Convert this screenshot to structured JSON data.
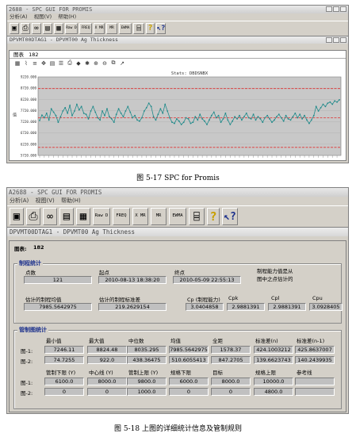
{
  "top": {
    "app_title": "2688 - SPC GUI FOR PROMIS",
    "menu": [
      "分析(A)",
      "视图(V)",
      "帮助(H)"
    ],
    "toolbar_labels": [
      "Raw D",
      "FREQ",
      "X MR",
      "MR",
      "EWMA"
    ],
    "doc_title": "DPVMT00DTAG1 - DPVMT00 Ag Thickness",
    "tab_label": "图表",
    "tab_value": "182",
    "chart_data": {
      "type": "line",
      "title": "Stats: DBDSNBX",
      "ylabel": "值",
      "yticks": [
        "9220.000",
        "8720.000",
        "8220.000",
        "7720.000",
        "7220.000",
        "6720.000",
        "6220.000",
        "5720.000"
      ],
      "ylim": [
        5720,
        9220
      ],
      "reference_lines": [
        {
          "name": "上限",
          "value": 8700,
          "color": "#e03030"
        },
        {
          "name": "中心",
          "value": 7400,
          "color": "#e03030"
        },
        {
          "name": "下限",
          "value": 6080,
          "color": "#e03030"
        }
      ],
      "series": [
        {
          "color": "#1f8a8a",
          "values": [
            7280,
            7520,
            7400,
            7600,
            7300,
            7800,
            7650,
            7500,
            7200,
            7450,
            7700,
            7850,
            7600,
            7950,
            7500,
            7700,
            8000,
            7750,
            7900,
            7600,
            7550,
            7350,
            7700,
            7900,
            7650,
            7400,
            7300,
            7700,
            7500,
            7800,
            7450,
            7350,
            7200,
            7550,
            7800,
            7600,
            7450,
            7700,
            7900,
            7650,
            7400,
            7500,
            7300,
            7250,
            7400,
            7700,
            7850,
            8050,
            7900,
            7450,
            7300,
            7550,
            7800,
            7600,
            8000,
            7700,
            7400,
            7200,
            7150,
            7350,
            7250,
            7100,
            7200,
            7400,
            7350,
            7150,
            7200,
            7450,
            7300,
            7550,
            7350,
            7250,
            7100,
            7300,
            7500,
            7650,
            7400,
            7500,
            7200,
            7350,
            7600,
            7300,
            7100,
            7250,
            7450,
            7350,
            7500,
            7300,
            7450,
            7600,
            7400,
            7350,
            7550,
            7300,
            7450,
            7350,
            7200,
            7400,
            7500,
            7350,
            7200,
            7300,
            7450,
            7550,
            7400,
            7250,
            7500,
            7350,
            7300,
            7450,
            7600,
            7400,
            7550,
            7350,
            7500,
            7300,
            7150,
            7300,
            7500,
            7900,
            7700,
            7850,
            8000,
            7900,
            8050,
            8100,
            8000,
            8150,
            8100,
            8200
          ]
        }
      ]
    }
  },
  "caption1": "图 5-17 SPC for Promis",
  "bottom": {
    "app_title": "A2688 - SPC GUI FOR PROMIS",
    "menu": [
      "分析(A)",
      "视图(V)",
      "帮助(H)"
    ],
    "toolbar_labels": [
      "Raw D",
      "FREQ",
      "X MR",
      "MR",
      "EWMA"
    ],
    "doc_title": "DPVMT00DTAG1 - DPVMT00 Ag Thickness",
    "tab_label": "图表:",
    "tab_value": "182",
    "process_group": {
      "title": "制程统计",
      "points_label": "点数",
      "points_value": "121",
      "start_label": "起点",
      "start_value": "2010-08-13 18:38:20",
      "end_label": "终点",
      "end_value": "2010-05-09 22:55:13",
      "note_line1": "制程能力值是从",
      "note_line2": "图中之点估计的",
      "mean_label": "估计的制程均值",
      "mean_value": "7985.5642975",
      "std_label": "估计的制程标准差",
      "std_value": "219.2629154",
      "cap_labels": [
        "Cp (制程能力)",
        "Cpk",
        "Cpl",
        "Cpu"
      ],
      "cap_values": [
        "3.0404858",
        "2.9881391",
        "2.9881391",
        "3.0928405"
      ]
    },
    "control_group": {
      "title": "管制图统计",
      "headers1": [
        "最小值",
        "最大值",
        "中位数",
        "均值",
        "全距",
        "标准差(n)",
        "标准差(n-1)"
      ],
      "rows1": [
        {
          "label": "图-1:",
          "values": [
            "7246.11",
            "8824.48",
            "8035.295",
            "7985.5642975",
            "1578.37",
            "424.1003212",
            "425.8637007"
          ]
        },
        {
          "label": "图-2:",
          "values": [
            "74.7255",
            "922.0",
            "438.36475",
            "510.6055413",
            "847.2705",
            "139.6623743",
            "140.2439935"
          ]
        }
      ],
      "headers2": [
        "管制下限 (Y)",
        "中心线 (Y)",
        "管制上限 (Y)",
        "规格下限",
        "目标",
        "规格上限",
        "参考线"
      ],
      "rows2": [
        {
          "label": "图-1:",
          "values": [
            "6100.0",
            "8000.0",
            "9800.0",
            "6000.0",
            "8000.0",
            "10000.0",
            ""
          ]
        },
        {
          "label": "图-2:",
          "values": [
            "0",
            "0",
            "1000.0",
            "0",
            "0",
            "4800.0",
            ""
          ]
        }
      ]
    }
  },
  "caption2": "图 5-18 上图的详细统计信息及管制规则"
}
